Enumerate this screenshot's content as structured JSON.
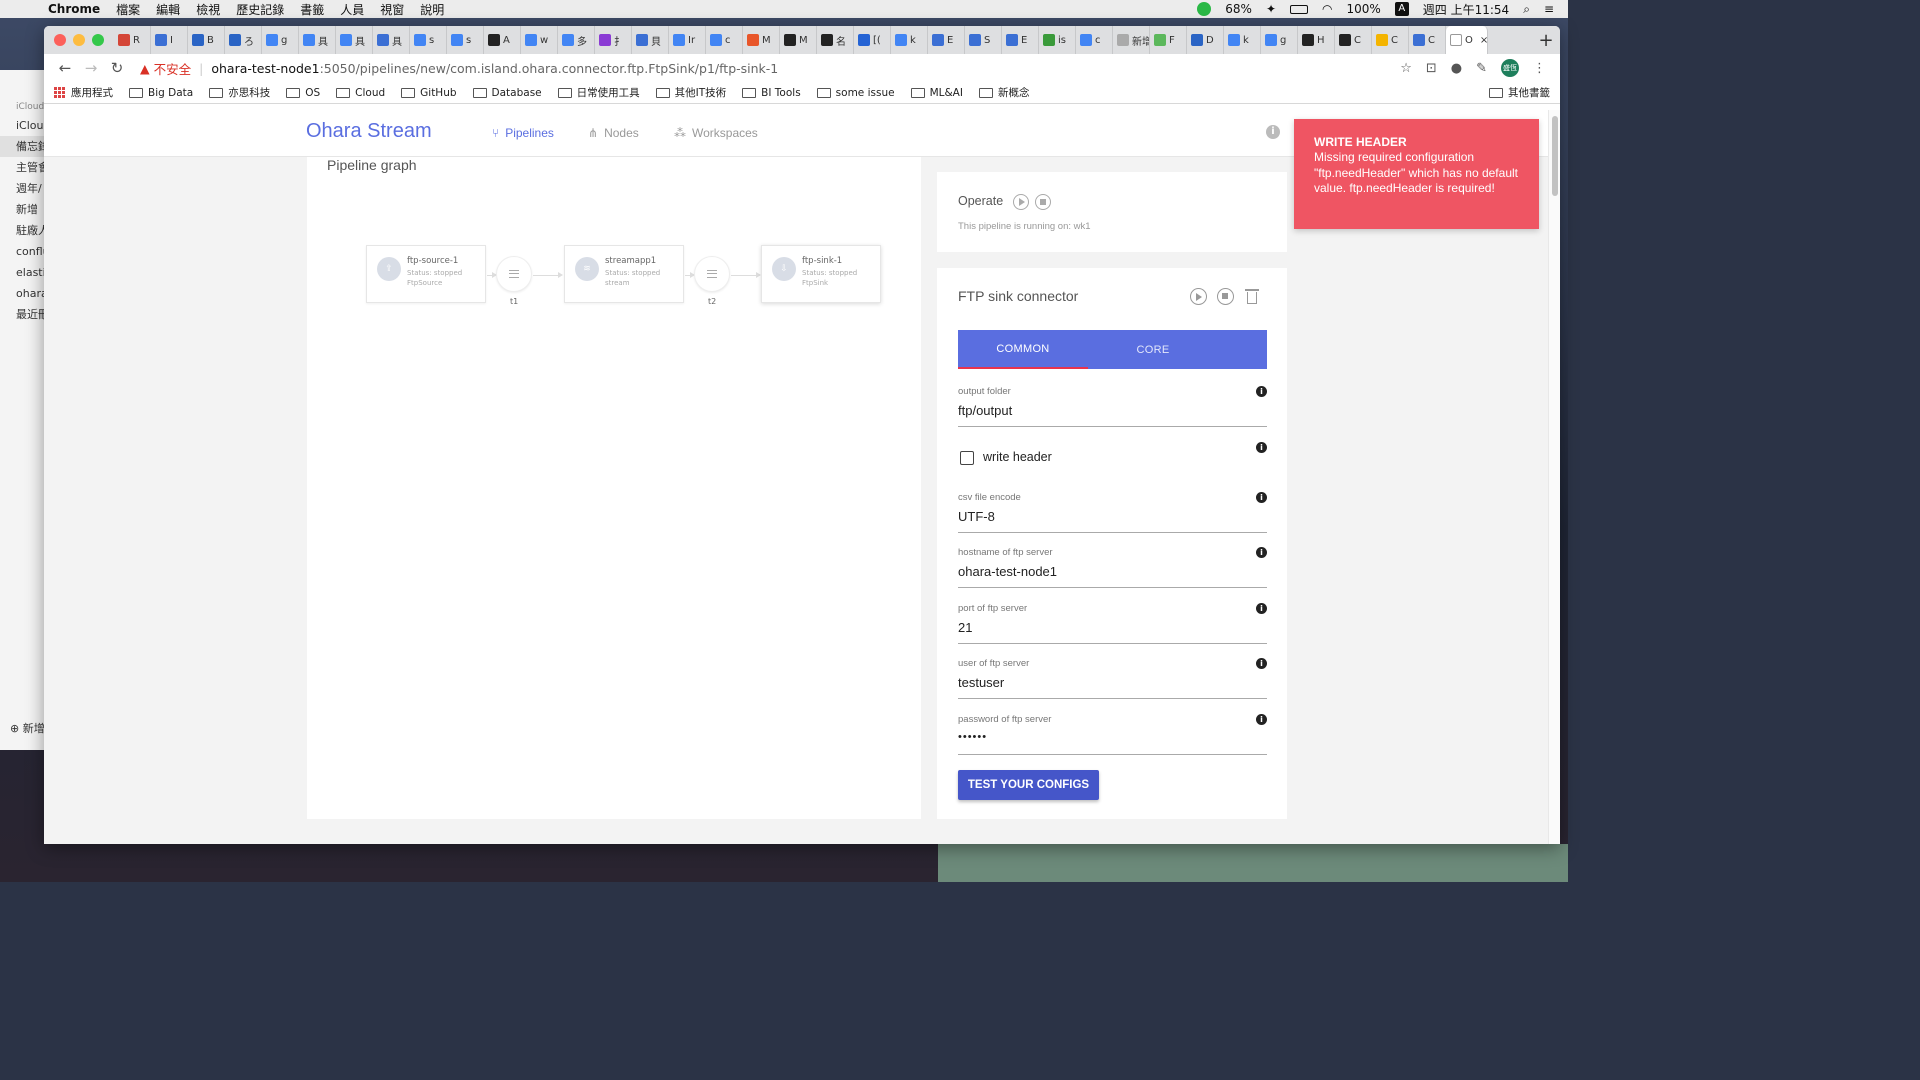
{
  "menubar": {
    "app": "Chrome",
    "items": [
      "檔案",
      "編輯",
      "檢視",
      "歷史記錄",
      "書籤",
      "人員",
      "視窗",
      "說明"
    ],
    "battery1": "68%",
    "battery2": "100%",
    "clock": "週四 上午11:54"
  },
  "notes": {
    "items": [
      "iCloud",
      "iCloud",
      "備忘錄",
      "主管會",
      "週年/",
      "新增",
      "駐廠人",
      "conflu",
      "elasti",
      "ohara",
      "最近刪"
    ],
    "add": "新增"
  },
  "browser": {
    "tabs": [
      {
        "label": "R",
        "color": "#d44638"
      },
      {
        "label": "I",
        "color": "#3b6fd4"
      },
      {
        "label": "B",
        "color": "#2a64c5"
      },
      {
        "label": "ろ",
        "color": "#2a64c5"
      },
      {
        "label": "g",
        "color": "#4285f4"
      },
      {
        "label": "具",
        "color": "#4285f4"
      },
      {
        "label": "具",
        "color": "#4285f4"
      },
      {
        "label": "具",
        "color": "#3b6fd4"
      },
      {
        "label": "s",
        "color": "#4285f4"
      },
      {
        "label": "s",
        "color": "#4285f4"
      },
      {
        "label": "A",
        "color": "#222"
      },
      {
        "label": "w",
        "color": "#4285f4"
      },
      {
        "label": "多",
        "color": "#4285f4"
      },
      {
        "label": "扌",
        "color": "#8a3bd4"
      },
      {
        "label": "貝",
        "color": "#3b6fd4"
      },
      {
        "label": "Ir",
        "color": "#4285f4"
      },
      {
        "label": "c",
        "color": "#4285f4"
      },
      {
        "label": "M",
        "color": "#e8562a"
      },
      {
        "label": "M",
        "color": "#222"
      },
      {
        "label": "名",
        "color": "#222"
      },
      {
        "label": "[(",
        "color": "#2463d4"
      },
      {
        "label": "k",
        "color": "#4285f4"
      },
      {
        "label": "E",
        "color": "#3b6fd4"
      },
      {
        "label": "S",
        "color": "#3b6fd4"
      },
      {
        "label": "E",
        "color": "#3b6fd4"
      },
      {
        "label": "is",
        "color": "#3a9a3a"
      },
      {
        "label": "c",
        "color": "#4285f4"
      },
      {
        "label": "新增",
        "color": "#aaa"
      },
      {
        "label": "F",
        "color": "#5cb85c"
      },
      {
        "label": "D",
        "color": "#2a64c5"
      },
      {
        "label": "k",
        "color": "#4285f4"
      },
      {
        "label": "g",
        "color": "#4285f4"
      },
      {
        "label": "H",
        "color": "#222"
      },
      {
        "label": "C",
        "color": "#222"
      },
      {
        "label": "C",
        "color": "#f4b400"
      },
      {
        "label": "C",
        "color": "#3b6fd4"
      },
      {
        "label": "O",
        "color": "#ffffff",
        "active": true
      }
    ],
    "insecure": "不安全",
    "url_host": "ohara-test-node1",
    "url_path": ":5050/pipelines/new/com.island.ohara.connector.ftp.FtpSink/p1/ftp-sink-1",
    "avatar": "盛恆",
    "bookmarks": [
      "應用程式",
      "Big Data",
      "亦思科技",
      "OS",
      "Cloud",
      "GitHub",
      "Database",
      "日常使用工具",
      "其他IT技術",
      "BI Tools",
      "some issue",
      "ML&AI",
      "新概念"
    ],
    "other_bookmarks": "其他書籤"
  },
  "app": {
    "brand": "Ohara Stream",
    "nav": [
      {
        "label": "Pipelines",
        "icon": "branch-icon",
        "active": true
      },
      {
        "label": "Nodes",
        "icon": "sitemap-icon",
        "active": false
      },
      {
        "label": "Workspaces",
        "icon": "network-icon",
        "active": false
      }
    ]
  },
  "graph": {
    "title": "Pipeline graph",
    "nodes": [
      {
        "name": "ftp-source-1",
        "status": "Status: stopped",
        "kind": "FtpSource",
        "icon": "source-icon"
      },
      {
        "name": "streamapp1",
        "status": "Status: stopped",
        "kind": "stream",
        "icon": "stream-icon"
      },
      {
        "name": "ftp-sink-1",
        "status": "Status: stopped",
        "kind": "FtpSink",
        "icon": "sink-icon"
      }
    ],
    "topics": [
      {
        "label": "t1"
      },
      {
        "label": "t2"
      }
    ]
  },
  "operate": {
    "title": "Operate",
    "note": "This pipeline is running on: wk1"
  },
  "sink": {
    "title": "FTP sink connector",
    "tabs": [
      "COMMON",
      "CORE"
    ],
    "fields": [
      {
        "label": "output folder",
        "value": "ftp/output"
      },
      {
        "label": "csv file encode",
        "value": "UTF-8"
      },
      {
        "label": "hostname of ftp server",
        "value": "ohara-test-node1"
      },
      {
        "label": "port of ftp server",
        "value": "21"
      },
      {
        "label": "user of ftp server",
        "value": "testuser"
      },
      {
        "label": "password of ftp server",
        "value": "••••••"
      }
    ],
    "checkbox_label": "write header",
    "test_button": "TEST YOUR CONFIGS"
  },
  "toast": {
    "title": "WRITE HEADER",
    "message": "Missing required configuration \"ftp.needHeader\" which has no default value. ftp.needHeader is required!"
  },
  "colors": {
    "accent": "#5a6ee0",
    "toast": "#ef5563",
    "tab_indicator": "#e8344e"
  }
}
